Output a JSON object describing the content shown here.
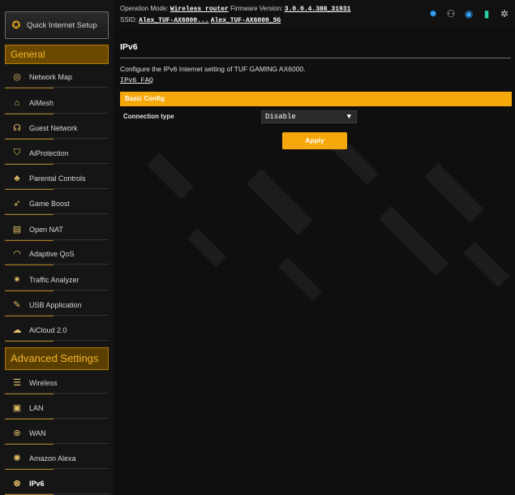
{
  "sidebar": {
    "quick_setup_label": "Quick Internet Setup",
    "general_header": "General",
    "general_items": [
      {
        "label": "Network Map",
        "icon": "network-map-icon"
      },
      {
        "label": "AiMesh",
        "icon": "aimesh-icon"
      },
      {
        "label": "Guest Network",
        "icon": "guest-network-icon"
      },
      {
        "label": "AiProtection",
        "icon": "aiprotection-icon"
      },
      {
        "label": "Parental Controls",
        "icon": "parental-controls-icon"
      },
      {
        "label": "Game Boost",
        "icon": "rocket-icon"
      },
      {
        "label": "Open NAT",
        "icon": "open-nat-icon"
      },
      {
        "label": "Adaptive QoS",
        "icon": "qos-gauge-icon"
      },
      {
        "label": "Traffic Analyzer",
        "icon": "traffic-analyzer-icon"
      },
      {
        "label": "USB Application",
        "icon": "usb-icon"
      },
      {
        "label": "AiCloud 2.0",
        "icon": "cloud-icon"
      }
    ],
    "advanced_header": "Advanced Settings",
    "advanced_items": [
      {
        "label": "Wireless",
        "icon": "wireless-icon"
      },
      {
        "label": "LAN",
        "icon": "lan-icon"
      },
      {
        "label": "WAN",
        "icon": "wan-globe-icon"
      },
      {
        "label": "Amazon Alexa",
        "icon": "alexa-icon"
      },
      {
        "label": "IPv6",
        "icon": "ipv6-globe-icon"
      }
    ]
  },
  "topbar": {
    "op_mode_label": "Operation Mode:",
    "op_mode_value": "Wireless router",
    "fw_label": "Firmware Version:",
    "fw_value": "3.0.0.4.388_31931",
    "ssid_label": "SSID:",
    "ssid_1": "Alex_TUF-AX6000...",
    "ssid_2": "Alex_TUF-AX6000_5G"
  },
  "main": {
    "title": "IPv6",
    "description": "Configure the IPv6 Internet setting of TUF GAMING AX6000.",
    "faq_link": "IPv6 FAQ",
    "section_title": "Basic Config",
    "connection_type_label": "Connection type",
    "connection_type_value": "Disable",
    "apply_label": "Apply"
  },
  "colors": {
    "accent": "#f6a80a",
    "section_header_bg": "#6b4a00",
    "background": "#0f0f0f"
  }
}
